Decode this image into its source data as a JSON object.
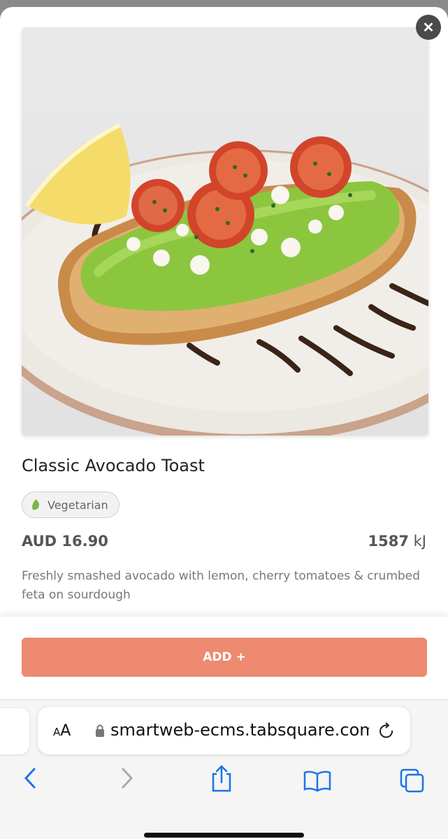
{
  "product": {
    "name": "Classic Avocado Toast",
    "tag": "Vegetarian",
    "price": "AUD 16.90",
    "energy_value": "1587",
    "energy_unit": "kJ",
    "description": "Freshly smashed avocado with lemon, cherry tomatoes & crumbed feta on sourdough"
  },
  "actions": {
    "add_label": "ADD +",
    "close_icon": "close-icon"
  },
  "browser": {
    "text_size_label_small": "A",
    "text_size_label_large": "A",
    "url": "smartweb-ecms.tabsquare.com",
    "icons": [
      "lock-icon",
      "reload-icon",
      "back-icon",
      "forward-icon",
      "share-icon",
      "bookmarks-icon",
      "tabs-icon"
    ]
  },
  "colors": {
    "accent": "#ee8a6f",
    "tag_leaf": "#7ab648",
    "ios_blue": "#1a73e8"
  }
}
